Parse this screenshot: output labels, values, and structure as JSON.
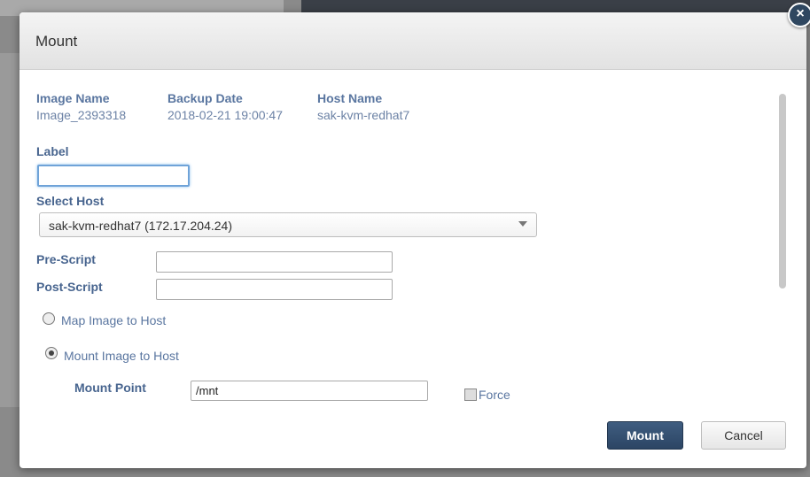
{
  "dialog": {
    "title": "Mount",
    "close_icon": "×"
  },
  "info": {
    "image_name_label": "Image Name",
    "image_name_value": "Image_2393318",
    "backup_date_label": "Backup Date",
    "backup_date_value": "2018-02-21 19:00:47",
    "host_name_label": "Host Name",
    "host_name_value": "sak-kvm-redhat7"
  },
  "form": {
    "label_label": "Label",
    "label_value": "",
    "select_host_label": "Select Host",
    "select_host_value": "sak-kvm-redhat7 (172.17.204.24)",
    "pre_script_label": "Pre-Script",
    "pre_script_value": "",
    "post_script_label": "Post-Script",
    "post_script_value": "",
    "map_image_label": "Map Image to Host",
    "mount_image_label": "Mount Image to Host",
    "mount_point_label": "Mount Point",
    "mount_point_value": "/mnt",
    "force_label": "Force"
  },
  "buttons": {
    "mount": "Mount",
    "cancel": "Cancel"
  },
  "colors": {
    "primary_button": "#2c4564",
    "label_text": "#48658f",
    "close_button": "#2f4760"
  }
}
